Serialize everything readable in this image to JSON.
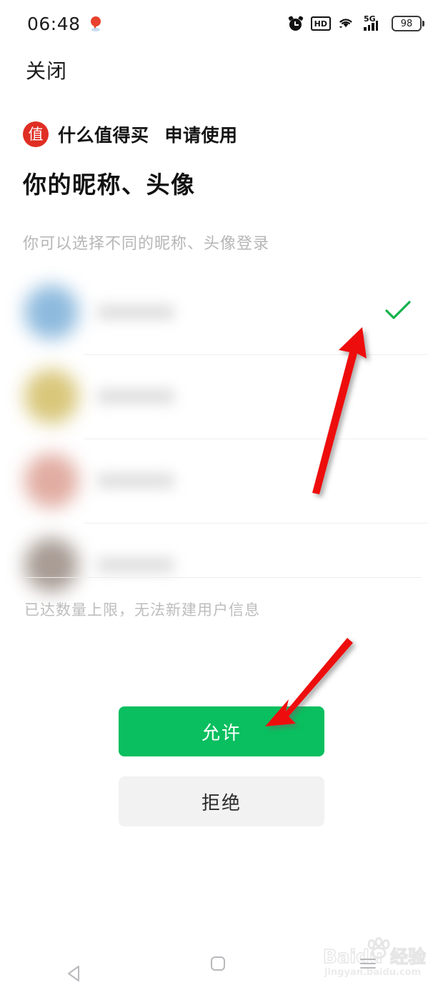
{
  "status_bar": {
    "time": "06:48",
    "location_icon": "location-pin-icon",
    "alarm_icon": "alarm-clock-icon",
    "hd_label": "HD",
    "wifi_icon": "wifi-icon",
    "network_label": "5G",
    "battery_percent": "98"
  },
  "header": {
    "close_label": "关闭"
  },
  "app": {
    "logo_char": "值",
    "logo_color": "#e02e24",
    "name": "什么值得买",
    "action": "申请使用"
  },
  "content": {
    "heading": "你的昵称、头像",
    "subtext": "你可以选择不同的昵称、头像登录",
    "limit_note": "已达数量上限，无法新建用户信息"
  },
  "accounts": [
    {
      "avatar_color": "#7aaed8",
      "selected": true
    },
    {
      "avatar_color": "#d2bd63",
      "selected": false
    },
    {
      "avatar_color": "#dc9e91",
      "selected": false
    },
    {
      "avatar_color": "#998b82",
      "selected": false
    }
  ],
  "buttons": {
    "allow_label": "允许",
    "allow_color": "#09bf5f",
    "deny_label": "拒绝",
    "deny_color": "#f2f2f2"
  },
  "annotations": {
    "arrow_color": "#ee1111",
    "arrow_to_checkmark": "arrow-pointing-to-selected-account",
    "arrow_to_allow": "arrow-pointing-to-allow-button"
  },
  "watermark": {
    "brand": "Baidu",
    "brand_cn": "经验",
    "url": "jingyan.baidu.com"
  },
  "nav_bar": {
    "back": "back-button",
    "home": "home-button",
    "recents": "recents-button"
  }
}
